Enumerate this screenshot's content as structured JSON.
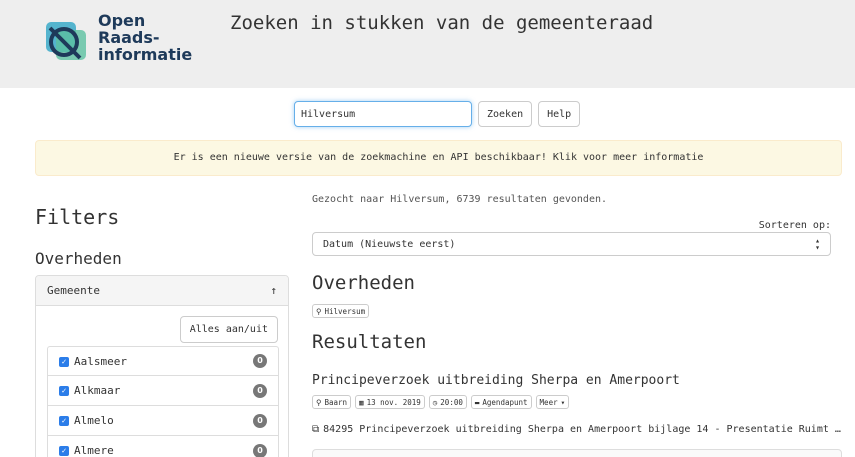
{
  "header": {
    "logo_line1": "Open",
    "logo_line2": "Raads-",
    "logo_line3": "informatie",
    "title": "Zoeken in stukken van de gemeenteraad"
  },
  "search": {
    "value": "Hilversum",
    "search_button": "Zoeken",
    "help_button": "Help"
  },
  "alert": "Er is een nieuwe versie van de zoekmachine en API beschikbaar! Klik voor meer informatie",
  "filters": {
    "title": "Filters",
    "section_title": "Overheden",
    "panel_title": "Gemeente",
    "panel_toggle": "↑",
    "toggle_all": "Alles aan/uit",
    "items": [
      {
        "label": "Aalsmeer",
        "count": "0"
      },
      {
        "label": "Alkmaar",
        "count": "0"
      },
      {
        "label": "Almelo",
        "count": "0"
      },
      {
        "label": "Almere",
        "count": "0"
      }
    ]
  },
  "results": {
    "summary": "Gezocht naar Hilversum, 6739 resultaten gevonden.",
    "sort_label": "Sorteren op:",
    "sort_value": "Datum (Nieuwste eerst)",
    "overheden_title": "Overheden",
    "overheden_tag": "Hilversum",
    "resultaten_title": "Resultaten",
    "item": {
      "title": "Principeverzoek uitbreiding Sherpa en Amerpoort",
      "location": "Baarn",
      "date": "13 nov. 2019",
      "time": "20:00",
      "type": "Agendapunt",
      "more": "Meer"
    },
    "doc": "84295 Principeverzoek uitbreiding Sherpa en Amerpoort bijlage 14 - Presentatie Ruimt …"
  },
  "colors": {
    "header_bg": "#eeeeee",
    "alert_bg": "#fcf8e3",
    "checkbox": "#2b7de9",
    "badge": "#777777",
    "focus": "#66afe9"
  }
}
